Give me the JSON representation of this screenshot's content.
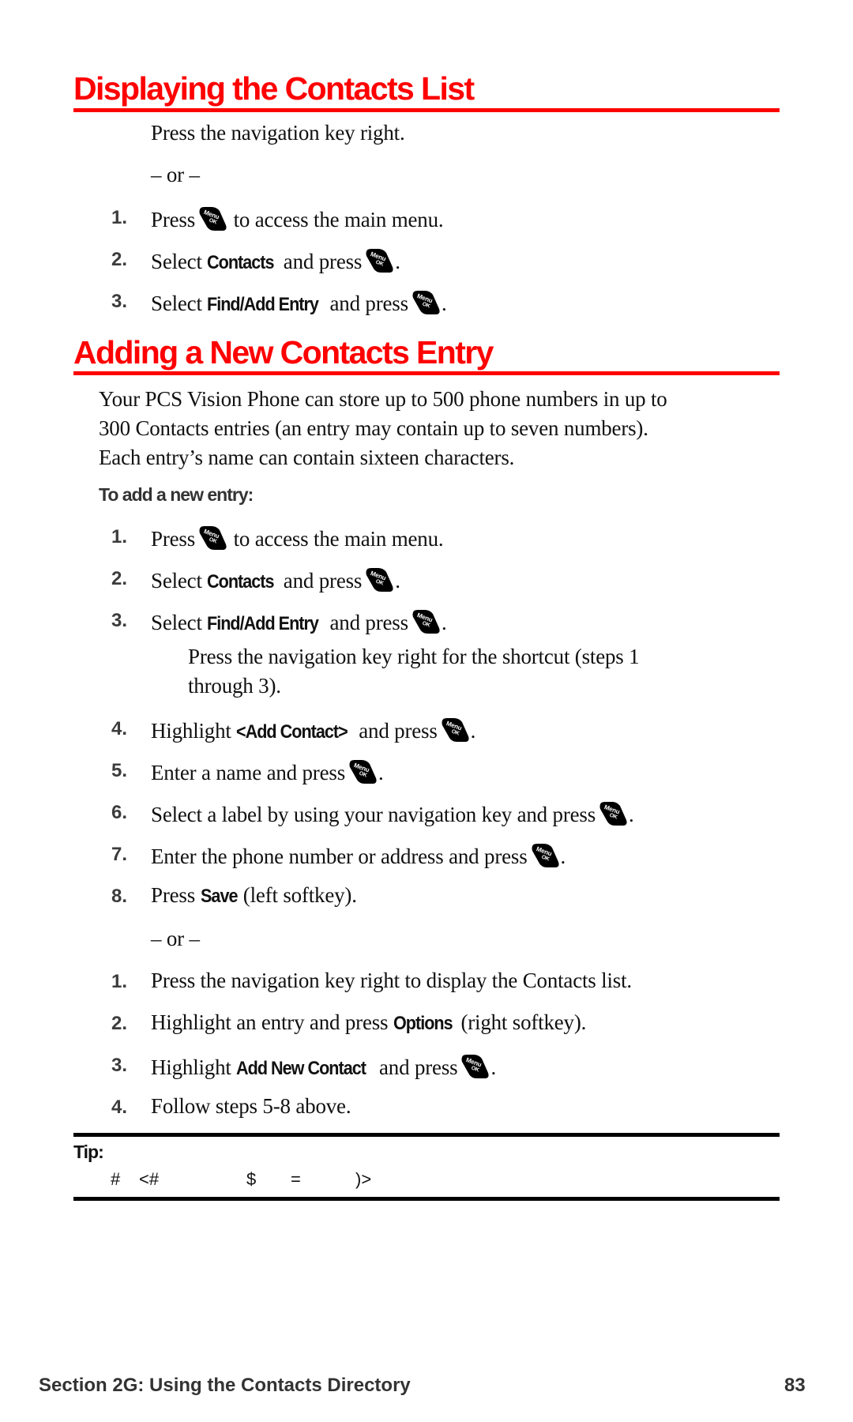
{
  "section1": {
    "title": "Displaying the Contacts List",
    "intro": "Press the navigation key right.",
    "or": "– or –",
    "steps": [
      {
        "num": "1.",
        "pre": "Press",
        "bold": "",
        "post": "to access the main menu.",
        "key_after_pre": true
      },
      {
        "num": "2.",
        "pre": "Select",
        "bold": "Contacts",
        "post": "and press",
        "end": "."
      },
      {
        "num": "3.",
        "pre": "Select",
        "bold": "Find/Add Entry",
        "post": "and press",
        "end": "."
      }
    ]
  },
  "section2": {
    "title": "Adding a New Contacts Entry",
    "paragraph": [
      "Your PCS Vision Phone can store up to 500 phone numbers in up to",
      "300 Contacts entries (an entry may contain up to seven numbers).",
      "Each entry’s name can contain sixteen characters."
    ],
    "subheading": "To add a new entry:",
    "steps": [
      {
        "num": "1.",
        "pre": "Press",
        "post": "to access the main menu."
      },
      {
        "num": "2.",
        "pre": "Select",
        "bold": "Contacts",
        "post": "and press",
        "end": "."
      },
      {
        "num": "3.",
        "pre": "Select",
        "bold": "Find/Add Entry",
        "post": "and press",
        "end": "."
      },
      {
        "note": [
          "Press the navigation key right for the shortcut (steps 1",
          "through 3)."
        ]
      },
      {
        "num": "4.",
        "pre": "Highlight",
        "bold": "<Add Contact>",
        "post": "and press",
        "end": "."
      },
      {
        "num": "5.",
        "pre": "Enter a name and press",
        "end": "."
      },
      {
        "num": "6.",
        "pre": "Select a label by using your navigation key and press",
        "end": "."
      },
      {
        "num": "7.",
        "pre": "Enter the phone number or address and press",
        "end": "."
      },
      {
        "num": "8.",
        "pre": "Press",
        "bold": "Save",
        "post": "(left softkey)."
      }
    ],
    "or": "– or –",
    "alt_steps": [
      {
        "num": "1.",
        "pre": "Press the navigation key right to display the Contacts list."
      },
      {
        "num": "2.",
        "pre": "Highlight an entry and press",
        "bold": "Options",
        "post": "(right softkey)."
      },
      {
        "num": "3.",
        "pre": "Highlight",
        "bold": "Add New Contact",
        "post": "and press",
        "end": "."
      },
      {
        "num": "4.",
        "pre": "Follow steps 5-8 above."
      }
    ]
  },
  "tip": {
    "label": "Tip:",
    "glyphs": [
      "#",
      "<#",
      "$",
      "=",
      ")>"
    ]
  },
  "icons": {
    "menu_ok_key": {
      "name": "menu-ok-key-icon",
      "line1": "Menu",
      "line2": "OK"
    }
  },
  "footer": {
    "section": "Section 2G: Using the Contacts Directory",
    "page": "83"
  },
  "colors": {
    "heading": "#ff0000",
    "rule_red": "#ff0000",
    "rule_black": "#000000",
    "step_number": "#3c3c3c"
  }
}
